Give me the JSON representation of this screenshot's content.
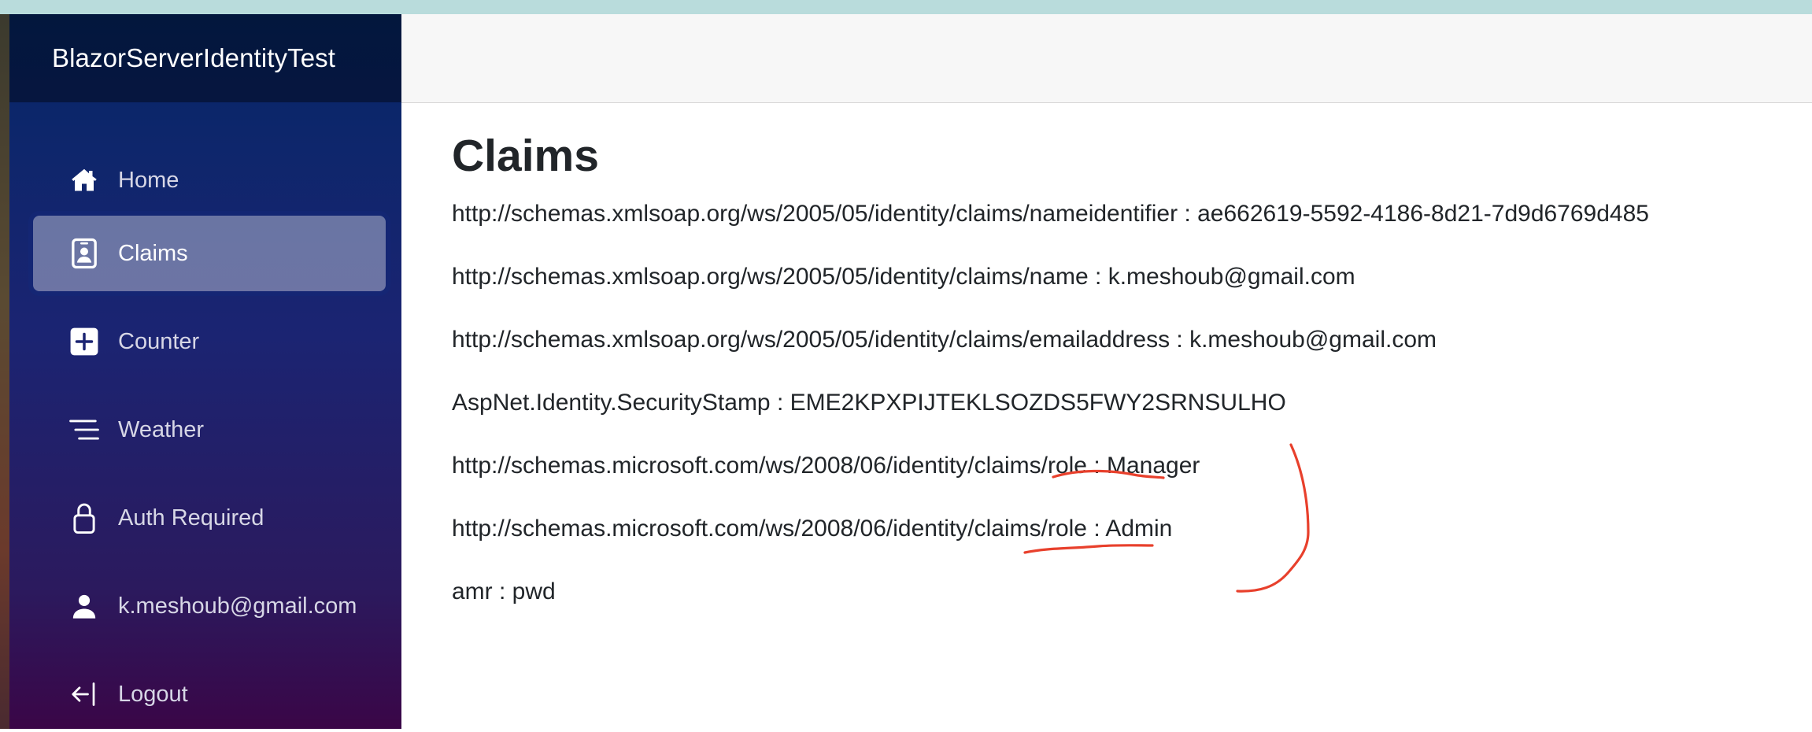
{
  "app": {
    "brand": "BlazorServerIdentityTest"
  },
  "sidebar": {
    "items": [
      {
        "label": "Home",
        "icon": "home-icon"
      },
      {
        "label": "Claims",
        "icon": "id-badge-icon",
        "active": true
      },
      {
        "label": "Counter",
        "icon": "plus-square-icon"
      },
      {
        "label": "Weather",
        "icon": "list-lines-icon"
      },
      {
        "label": "Auth Required",
        "icon": "lock-icon"
      },
      {
        "label": "k.meshoub@gmail.com",
        "icon": "person-icon"
      },
      {
        "label": "Logout",
        "icon": "logout-arrow-icon"
      }
    ]
  },
  "main": {
    "title": "Claims",
    "claims": [
      "http://schemas.xmlsoap.org/ws/2005/05/identity/claims/nameidentifier : ae662619-5592-4186-8d21-7d9d6769d485",
      "http://schemas.xmlsoap.org/ws/2005/05/identity/claims/name : k.meshoub@gmail.com",
      "http://schemas.xmlsoap.org/ws/2005/05/identity/claims/emailaddress : k.meshoub@gmail.com",
      "AspNet.Identity.SecurityStamp : EME2KPXPIJTEKLSOZDS5FWY2SRNSULHO",
      "http://schemas.microsoft.com/ws/2008/06/identity/claims/role : Manager",
      "http://schemas.microsoft.com/ws/2008/06/identity/claims/role : Admin",
      "amr : pwd"
    ]
  },
  "colors": {
    "sidebar_top": "#052767",
    "sidebar_bottom": "#3a0647",
    "annotation": "#e8402c",
    "text": "#212529"
  }
}
